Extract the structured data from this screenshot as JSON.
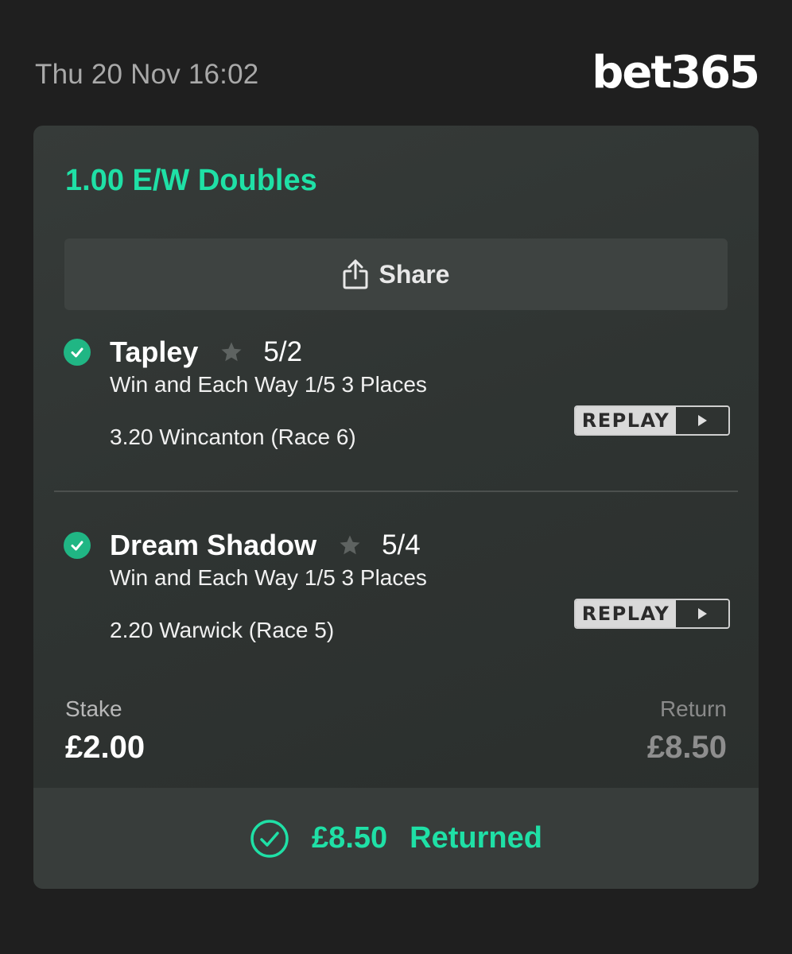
{
  "header": {
    "datetime": "Thu 20 Nov 16:02",
    "logo_text": "bet365"
  },
  "bet": {
    "title": "1.00 E/W Doubles",
    "share_label": "Share",
    "selections": [
      {
        "horse": "Tapley",
        "odds": "5/2",
        "market": "Win and Each Way 1/5 3 Places",
        "race": "3.20 Wincanton (Race 6)",
        "replay_label": "REPLAY",
        "status": "won"
      },
      {
        "horse": "Dream Shadow",
        "odds": "5/4",
        "market": "Win and Each Way 1/5 3 Places",
        "race": "2.20 Warwick (Race 5)",
        "replay_label": "REPLAY",
        "status": "won"
      }
    ],
    "stake_label": "Stake",
    "stake_value": "£2.00",
    "return_label": "Return",
    "return_value": "£8.50",
    "returned_amount": "£8.50",
    "returned_label": "Returned"
  },
  "colors": {
    "accent": "#1fe0a6",
    "check_fill": "#20b684",
    "background": "#1f1f1f",
    "card": "#323735"
  },
  "icons": {
    "share": "share-icon",
    "check": "check-circle-icon",
    "star": "star-icon",
    "play": "play-icon",
    "returned": "check-outline-circle-icon"
  }
}
